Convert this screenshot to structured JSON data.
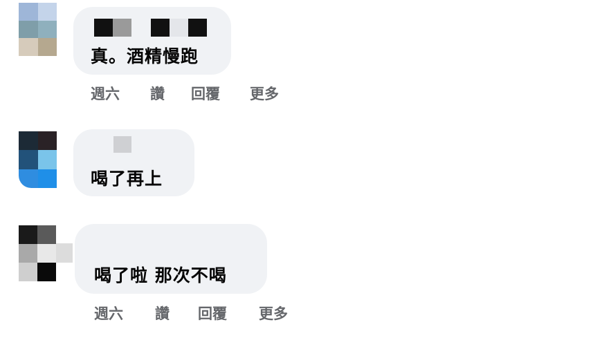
{
  "comments": [
    {
      "text": "真。酒精慢跑",
      "actions": [
        "週六",
        "讚",
        "回覆",
        "更多"
      ],
      "avatar_colors": [
        "#9eb6d8",
        "#c4d4ea",
        "#7f9ea9",
        "#8fb0bd",
        "#d6cbbb",
        "#b5a88f"
      ],
      "name_redaction_colors": [
        "#111111",
        "#9a9a9a",
        "#f0f2f5",
        "#111111",
        "#e4e6ea",
        "#111111"
      ]
    },
    {
      "text": "喝了再上",
      "actions": [],
      "avatar_colors": [
        "#1c2a36",
        "#2a2226",
        "#22527a",
        "#7ac4ea",
        "#2f8de0",
        "#1f8fe8"
      ],
      "name_redaction_colors": [
        "#cfd0d3"
      ]
    },
    {
      "text": "喝了啦 那次不喝",
      "actions": [
        "週六",
        "讚",
        "回覆",
        "更多"
      ],
      "avatar_colors": [
        "#1a1a1a",
        "#5a5a5a",
        "#a9a9a9",
        "#e8e8e8",
        "#cfcfcf",
        "#0a0a0a"
      ],
      "name_redaction_colors": []
    }
  ]
}
